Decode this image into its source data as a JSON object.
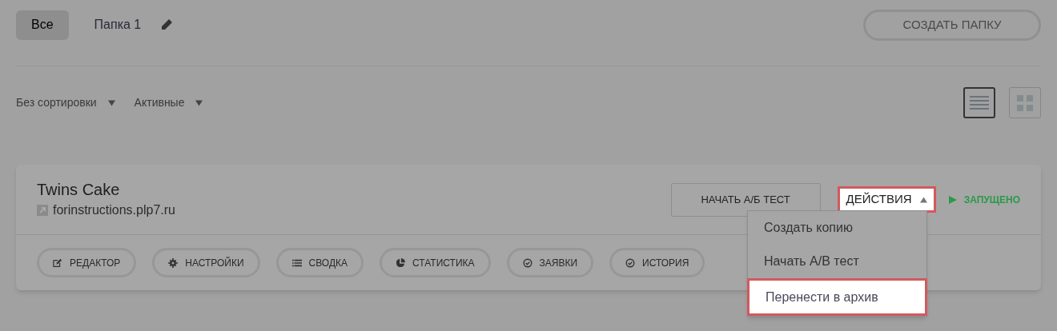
{
  "tabs": [
    {
      "label": "Все",
      "selected": true,
      "editable": false
    },
    {
      "label": "Папка 1",
      "selected": false,
      "editable": true
    }
  ],
  "create_folder_button": "СОЗДАТЬ ПАПКУ",
  "filters": [
    {
      "label": "Без сортировки"
    },
    {
      "label": "Активные"
    }
  ],
  "view_toggles": [
    {
      "kind": "list",
      "selected": true
    },
    {
      "kind": "grid",
      "selected": false
    }
  ],
  "project": {
    "title": "Twins Cake",
    "url": "forinstructions.plp7.ru",
    "ab_button": "НАЧАТЬ А/Б ТЕСТ",
    "actions": {
      "label": "ДЕЙСТВИЯ",
      "expanded": true,
      "highlighted": true
    },
    "status": "ЗАПУЩЕНО",
    "menu": [
      {
        "label": "Создать копию",
        "highlighted": false
      },
      {
        "label": "Начать A/B тест",
        "highlighted": false
      },
      {
        "label": "Перенести в архив",
        "highlighted": true
      }
    ],
    "buttons": [
      {
        "kind": "edit",
        "label": "РЕДАКТОР"
      },
      {
        "kind": "gear",
        "label": "НАСТРОЙКИ"
      },
      {
        "kind": "list",
        "label": "СВОДКА"
      },
      {
        "kind": "pie",
        "label": "СТАТИСТИКА"
      },
      {
        "kind": "check",
        "label": "ЗАЯВКИ"
      },
      {
        "kind": "check",
        "label": "ИСТОРИЯ"
      }
    ]
  }
}
